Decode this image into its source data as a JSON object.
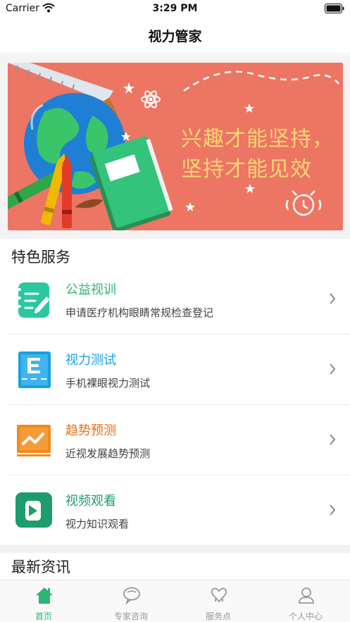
{
  "status_bar": {
    "carrier": "Carrier",
    "time": "3:29 PM"
  },
  "nav": {
    "title": "视力管家"
  },
  "banner": {
    "line1": "兴趣才能坚持，",
    "line2": "坚持才能见效"
  },
  "featured": {
    "title": "特色服务",
    "items": [
      {
        "name": "公益视训",
        "desc": "申请医疗机构眼睛常规检查登记",
        "color": "#2bb673",
        "icon": "notebook-pen-icon"
      },
      {
        "name": "视力测试",
        "desc": "手机裸眼视力测试",
        "color": "#1a9fe0",
        "icon": "eye-chart-icon"
      },
      {
        "name": "趋势预测",
        "desc": "近视发展趋势预测",
        "color": "#ee6c12",
        "icon": "trend-chart-icon"
      },
      {
        "name": "视频观看",
        "desc": "视力知识观看",
        "color": "#1e9c6b",
        "icon": "play-video-icon"
      }
    ]
  },
  "news": {
    "title": "最新资讯"
  },
  "tabs": [
    {
      "label": "首页",
      "icon": "home-icon",
      "active": true
    },
    {
      "label": "专家咨询",
      "icon": "chat-bubble-icon",
      "active": false
    },
    {
      "label": "服务点",
      "icon": "service-point-icon",
      "active": false
    },
    {
      "label": "个人中心",
      "icon": "user-icon",
      "active": false
    }
  ],
  "colors": {
    "accent": "#2bb673",
    "banner_bg": "#ec7564",
    "slogan": "#f9d872"
  }
}
